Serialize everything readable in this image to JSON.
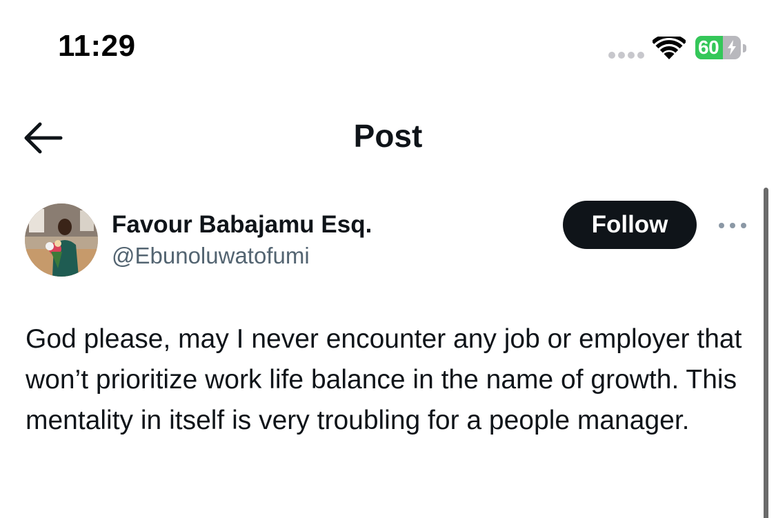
{
  "status_bar": {
    "time": "11:29",
    "battery_percent": "60",
    "battery_level": 0.6,
    "charging": true,
    "icons": [
      "signal-dots-icon",
      "wifi-icon",
      "battery-charging-icon"
    ]
  },
  "nav": {
    "title": "Post",
    "back_icon": "arrow-left-icon"
  },
  "post": {
    "author_name": "Favour Babajamu Esq.",
    "author_handle": "@Ebunoluwatofumi",
    "follow_label": "Follow",
    "more_icon": "ellipsis-icon",
    "text": "God please, may I never encounter any job or employer that won’t prioritize work life balance in the name of growth. This mentality in itself is very troubling for a people manager."
  },
  "colors": {
    "text_primary": "#0f1419",
    "text_secondary": "#536471",
    "battery_green": "#34c759",
    "follow_bg": "#0f1419"
  }
}
